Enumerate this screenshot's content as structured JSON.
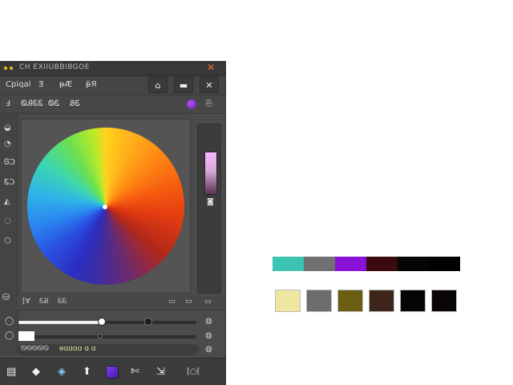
{
  "window": {
    "title": "CH EXIIUBBIBGOE",
    "close_glyph": "✕"
  },
  "menubar": {
    "items": [
      "Cpiqal",
      "Ǝ",
      "ᵽÆ",
      "ᵽ̈Я"
    ],
    "buttons": [
      "⌂",
      "▬",
      "✕"
    ]
  },
  "toolbar": {
    "items": [
      "Ⅎ",
      "ᏫᎯᏋᏋ",
      "ᏫᏋ",
      "ᏰᏋ"
    ],
    "right_icon": "⎘",
    "accent_color": "#8a2be2"
  },
  "side": {
    "icons": [
      "◒",
      "◔",
      "ᎶƆ",
      "ᏋƆ",
      "◭",
      "◌",
      "⬡"
    ],
    "flag_icon": "⛁"
  },
  "color_wheel": {
    "label": "color-wheel",
    "swatch_icon": "◙"
  },
  "below_row": {
    "items": [
      "⁅Ɐ",
      "ᏋᏰ",
      "ᏋᏋ",
      "▭",
      "▭",
      "▭"
    ]
  },
  "sliders": [
    {
      "icon": "◯",
      "value": 0.47,
      "knob2": 0.73,
      "end_icon": "◍"
    },
    {
      "icon": "◯",
      "value": 0.0,
      "knob2": 0.47,
      "end_icon": "◍"
    }
  ],
  "hex_row": {
    "text": "ᏫᏫᏫᏫᏫ",
    "glyphs": "ɵɑɑɑɑ ɑ ɑ",
    "end_icon": "◍"
  },
  "bottombar": {
    "icons": [
      "▤",
      "◆",
      "◈",
      "⬆",
      "▣",
      "✄",
      "⇲"
    ],
    "right_label": "⁅○⁅"
  },
  "palette_strip": [
    "#3cc3b3",
    "#717171",
    "#8a12d6",
    "#3a0a10",
    "#050505",
    "#000000"
  ],
  "swatches": [
    "#efe6a2",
    "#6d6d6d",
    "#6b5e12",
    "#3e251a",
    "#050505",
    "#0a0606"
  ]
}
